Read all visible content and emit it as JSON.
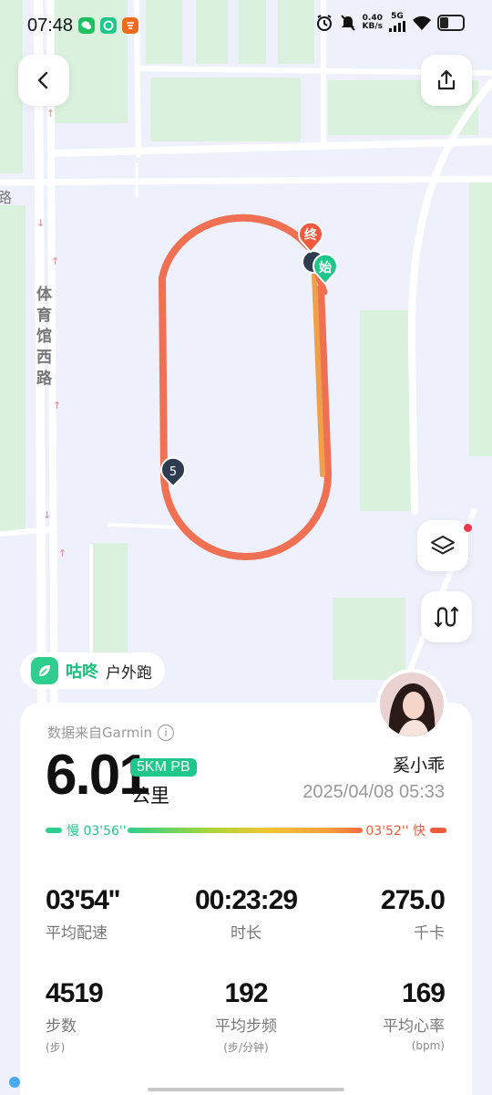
{
  "status_bar": {
    "time": "07:48",
    "net_speed_value": "0.40",
    "net_speed_unit": "KB/s",
    "signal_label": "5G"
  },
  "map": {
    "road_label": "体育馆西路",
    "road_label_left": "路",
    "start_marker": "始",
    "end_marker": "终",
    "km_marker": "5"
  },
  "app_badge": {
    "brand": "咕咚",
    "activity_type": "户外跑"
  },
  "summary": {
    "data_source": "数据来自Garmin",
    "distance": "6.01",
    "distance_unit": "公里",
    "pb_badge": "5KM PB",
    "user_name": "奚小乖",
    "datetime": "2025/04/08 05:33",
    "pace_slow_label": "慢 03'56''",
    "pace_fast_label": "03'52'' 快"
  },
  "stats": [
    {
      "value": "03'54''",
      "label": "平均配速",
      "unit": ""
    },
    {
      "value": "00:23:29",
      "label": "时长",
      "unit": ""
    },
    {
      "value": "275.0",
      "label": "千卡",
      "unit": ""
    },
    {
      "value": "4519",
      "label": "步数",
      "unit": "(步)"
    },
    {
      "value": "192",
      "label": "平均步频",
      "unit": "(步/分钟)"
    },
    {
      "value": "169",
      "label": "平均心率",
      "unit": "(bpm)"
    }
  ],
  "colors": {
    "accent": "#1fc78a",
    "fast": "#ef5a3c",
    "track": "#ef7052"
  }
}
